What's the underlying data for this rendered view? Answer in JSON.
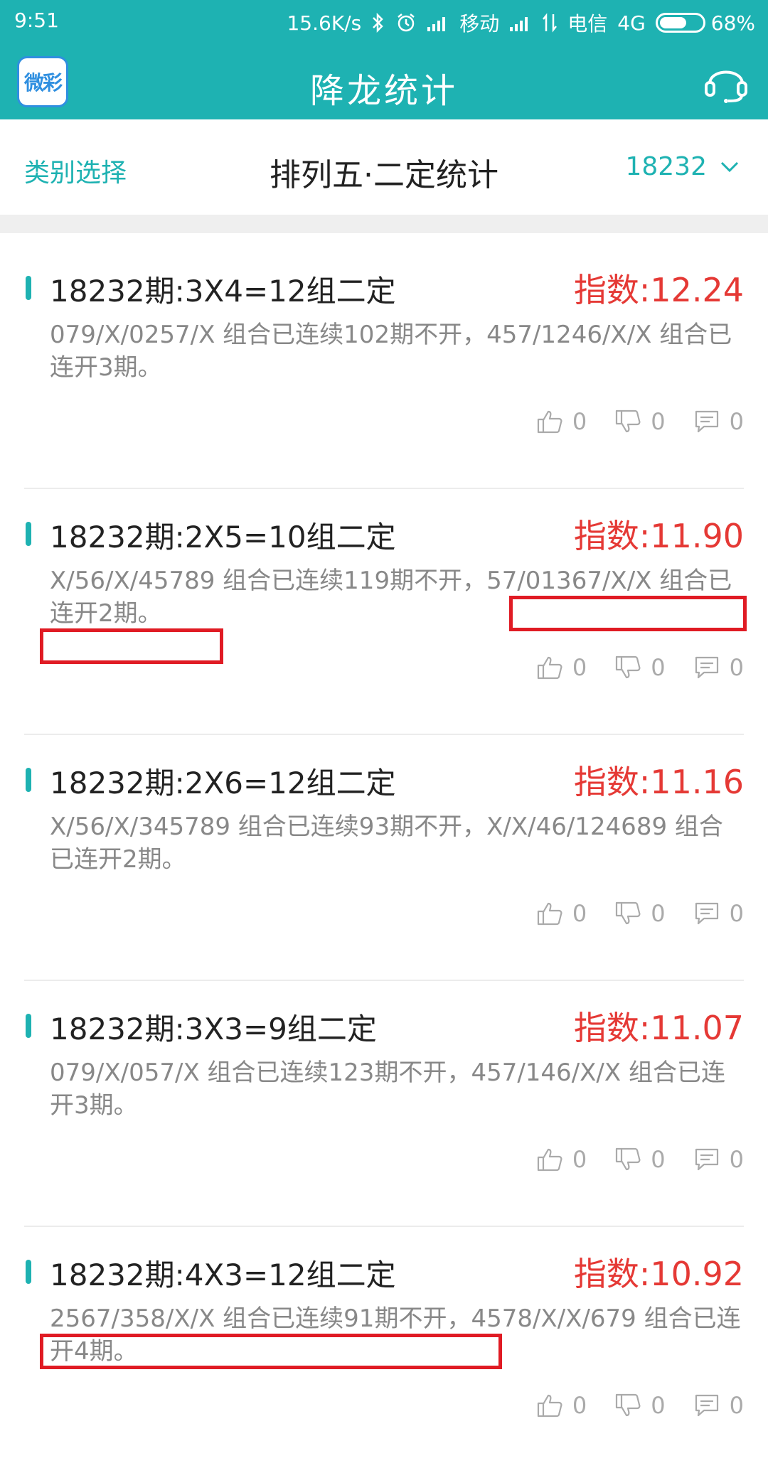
{
  "status_bar": {
    "time": "9:51",
    "net_speed": "15.6K/s",
    "carrier1": "移动",
    "carrier2": "电信",
    "network": "4G",
    "battery": "68%",
    "battery_level": 0.68
  },
  "app_bar": {
    "logo_text": "微彩",
    "title": "降龙统计"
  },
  "filter": {
    "category_label": "类别选择",
    "section_title": "排列五·二定统计",
    "issue": "18232"
  },
  "cards": [
    {
      "title": "18232期:3X4=12组二定",
      "index": "指数:12.24",
      "desc": "079/X/0257/X 组合已连续102期不开，457/1246/X/X 组合已连开3期。",
      "likes": "0",
      "dislikes": "0",
      "comments": "0"
    },
    {
      "title": "18232期:2X5=10组二定",
      "index": "指数:11.90",
      "desc": "X/56/X/45789 组合已连续119期不开，57/01367/X/X 组合已连开2期。",
      "likes": "0",
      "dislikes": "0",
      "comments": "0"
    },
    {
      "title": "18232期:2X6=12组二定",
      "index": "指数:11.16",
      "desc": "X/56/X/345789 组合已连续93期不开，X/X/46/124689 组合已连开2期。",
      "likes": "0",
      "dislikes": "0",
      "comments": "0"
    },
    {
      "title": "18232期:3X3=9组二定",
      "index": "指数:11.07",
      "desc": "079/X/057/X 组合已连续123期不开，457/146/X/X 组合已连开3期。",
      "likes": "0",
      "dislikes": "0",
      "comments": "0"
    },
    {
      "title": "18232期:4X3=12组二定",
      "index": "指数:10.92",
      "desc": "2567/358/X/X 组合已连续91期不开，4578/X/X/679 组合已连开4期。",
      "likes": "0",
      "dislikes": "0",
      "comments": "0"
    }
  ],
  "colors": {
    "primary": "#1eb2b2",
    "index_red": "#e53935",
    "highlight_red": "#e01b24",
    "desc_gray": "#888888"
  }
}
